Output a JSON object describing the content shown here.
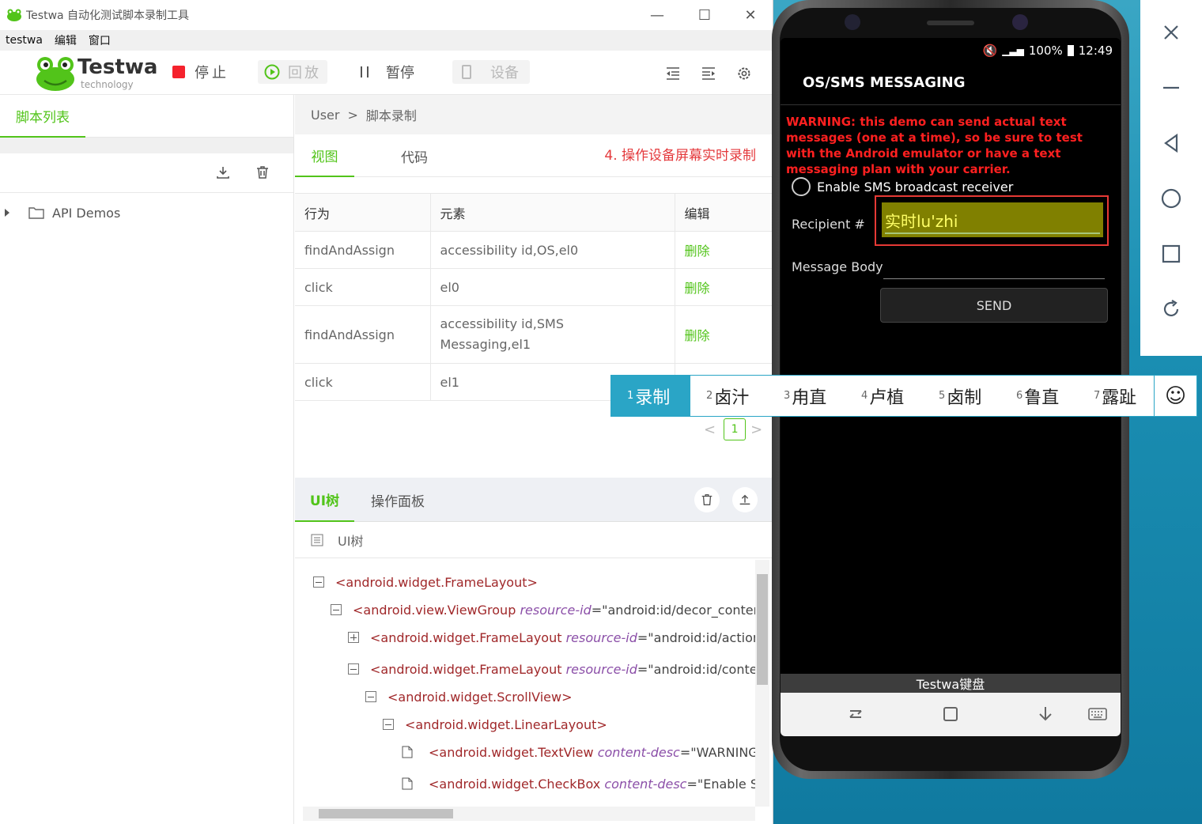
{
  "window": {
    "title": "Testwa 自动化测试脚本录制工具",
    "controls": {
      "minimize": "—",
      "maximize": "☐",
      "close": "✕"
    }
  },
  "menubar": {
    "items": [
      "testwa",
      "编辑",
      "窗口"
    ]
  },
  "brand": {
    "name": "Testwa",
    "sub": "technology",
    "color": "#52c41a"
  },
  "toolbar": {
    "stop_label": "停止",
    "replay_label": "回放",
    "pause_label": "暂停",
    "device_label": "设备",
    "stop_color": "#f5222d"
  },
  "left_panel": {
    "tab_label": "脚本列表",
    "tree": [
      {
        "label": "API Demos"
      }
    ]
  },
  "breadcrumb": {
    "root": "User",
    "separator": ">",
    "current": "脚本录制"
  },
  "view_tabs": {
    "view": "视图",
    "code": "代码",
    "hint": "4. 操作设备屏幕实时录制"
  },
  "script_table": {
    "headers": [
      "行为",
      "元素",
      "编辑"
    ],
    "rows": [
      {
        "action": "findAndAssign",
        "element": "accessibility id,OS,el0",
        "edit": "删除"
      },
      {
        "action": "click",
        "element": "el0",
        "edit": "删除"
      },
      {
        "action": "findAndAssign",
        "element": "accessibility id,SMS Messaging,el1",
        "edit": "删除"
      },
      {
        "action": "click",
        "element": "el1",
        "edit": ""
      }
    ]
  },
  "pager": {
    "prev": "<",
    "page": "1",
    "next": ">"
  },
  "ui_tabs": {
    "tree": "UI树",
    "ops": "操作面板",
    "subheader": "UI树"
  },
  "ui_tree": {
    "n1": {
      "tag": "<android.widget.FrameLayout>"
    },
    "n2": {
      "tag": "<android.view.ViewGroup",
      "attr": "resource-id",
      "val": "=\"android:id/decor_content"
    },
    "n3": {
      "tag": "<android.widget.FrameLayout",
      "attr": "resource-id",
      "val": "=\"android:id/action_"
    },
    "n4": {
      "tag": "<android.widget.FrameLayout",
      "attr": "resource-id",
      "val": "=\"android:id/conten"
    },
    "n5": {
      "tag": "<android.widget.ScrollView>"
    },
    "n6": {
      "tag": "<android.widget.LinearLayout>"
    },
    "n7": {
      "tag": "<android.widget.TextView",
      "attr": "content-desc",
      "val": "=\"WARNING: t"
    },
    "n8": {
      "tag": "<android.widget.CheckBox",
      "attr": "content-desc",
      "val": "=\"Enable SMS"
    }
  },
  "phone": {
    "status": {
      "battery": "100%",
      "time": "12:49"
    },
    "title": "OS/SMS MESSAGING",
    "warning": "WARNING: this demo can send actual text messages (one at a time), so be sure to test with the Android emulator or have a text messaging plan with your carrier.",
    "checkbox_label": "Enable SMS broadcast receiver",
    "recipient_label": "Recipient #",
    "recipient_value": "实时lu'zhi",
    "body_label": "Message Body",
    "send_label": "SEND",
    "keyboard_name": "Testwa键盘"
  },
  "ime": {
    "candidates": [
      {
        "n": "1",
        "text": "录制"
      },
      {
        "n": "2",
        "text": "卤汁"
      },
      {
        "n": "3",
        "text": "甪直"
      },
      {
        "n": "4",
        "text": "卢植"
      },
      {
        "n": "5",
        "text": "卤制"
      },
      {
        "n": "6",
        "text": "鲁直"
      },
      {
        "n": "7",
        "text": "露趾"
      }
    ],
    "emoji": "☺"
  },
  "emulator_controls": [
    "close-icon",
    "minimize-icon",
    "back-icon",
    "home-icon",
    "overview-icon",
    "rotate-icon"
  ]
}
